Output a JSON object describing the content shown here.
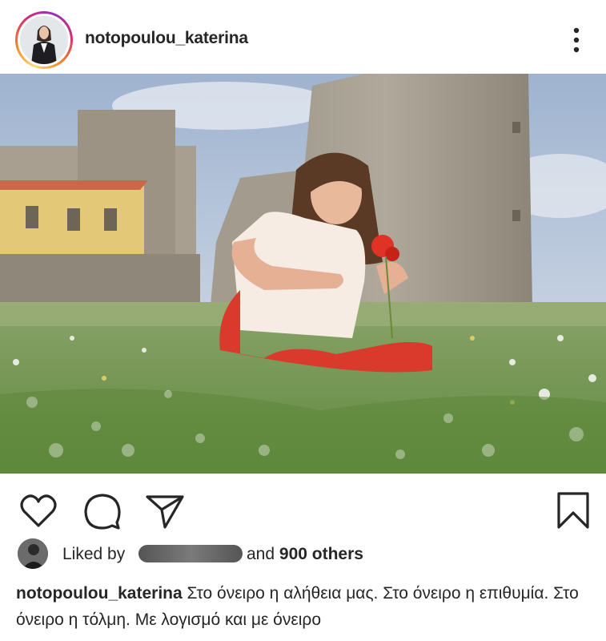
{
  "post": {
    "username": "notopoulou_katerina",
    "photo_alt": "Woman sitting in a flower meadow holding a red poppy in front of an old stone wall"
  },
  "likes": {
    "liked_by_label": "Liked by",
    "and_label": "and",
    "others_label": "900 others"
  },
  "caption": {
    "username": "notopoulou_katerina",
    "text": "Στο όνειρο η αλήθεια μας. Στο όνειρο η επιθυμία. Στο όνειρο η τόλμη. Με λογισμό και με όνειρο"
  }
}
